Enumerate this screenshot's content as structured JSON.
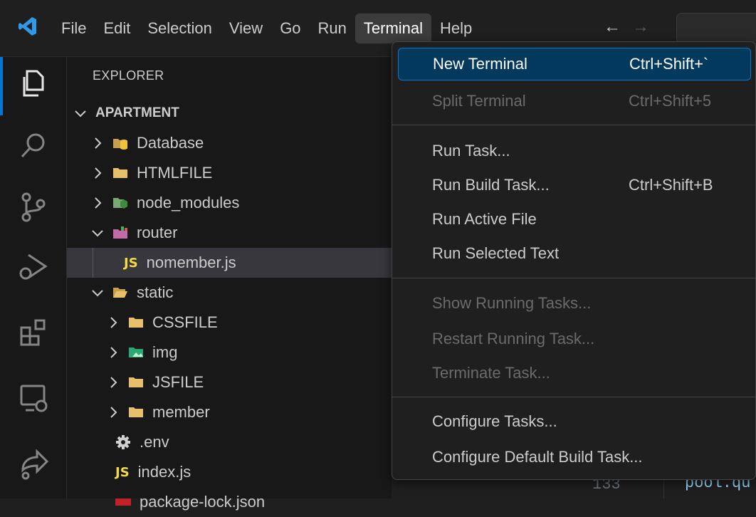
{
  "menubar": [
    "File",
    "Edit",
    "Selection",
    "View",
    "Go",
    "Run",
    "Terminal",
    "Help"
  ],
  "nav": {
    "back": "←",
    "forward": "→"
  },
  "explorer": {
    "title": "EXPLORER",
    "root": "APARTMENT",
    "items": [
      {
        "label": "Database",
        "type": "folder-db"
      },
      {
        "label": "HTMLFILE",
        "type": "folder"
      },
      {
        "label": "node_modules",
        "type": "folder-node"
      },
      {
        "label": "router",
        "type": "folder-router"
      },
      {
        "label": "nomember.js",
        "type": "js"
      },
      {
        "label": "static",
        "type": "folder-open"
      },
      {
        "label": "CSSFILE",
        "type": "folder"
      },
      {
        "label": "img",
        "type": "folder-img"
      },
      {
        "label": "JSFILE",
        "type": "folder"
      },
      {
        "label": "member",
        "type": "folder"
      },
      {
        "label": ".env",
        "type": "gear"
      },
      {
        "label": "index.js",
        "type": "js"
      },
      {
        "label": "package-lock.json",
        "type": "json"
      }
    ],
    "js_badge": "JS"
  },
  "terminal_menu": {
    "items": [
      {
        "label": "New Terminal",
        "key": "Ctrl+Shift+`"
      },
      {
        "label": "Split Terminal",
        "key": "Ctrl+Shift+5"
      },
      {
        "label": "Run Task...",
        "key": ""
      },
      {
        "label": "Run Build Task...",
        "key": "Ctrl+Shift+B"
      },
      {
        "label": "Run Active File",
        "key": ""
      },
      {
        "label": "Run Selected Text",
        "key": ""
      },
      {
        "label": "Show Running Tasks...",
        "key": ""
      },
      {
        "label": "Restart Running Task...",
        "key": ""
      },
      {
        "label": "Terminate Task...",
        "key": ""
      },
      {
        "label": "Configure Tasks...",
        "key": ""
      },
      {
        "label": "Configure Default Build Task...",
        "key": ""
      }
    ]
  },
  "editor": {
    "line_number": "133",
    "code": "pool.qu"
  },
  "colors": {
    "accent": "#0078d4",
    "highlight": "#04395e",
    "js_yellow": "#f1dd3f",
    "folder": "#e8c06a"
  }
}
